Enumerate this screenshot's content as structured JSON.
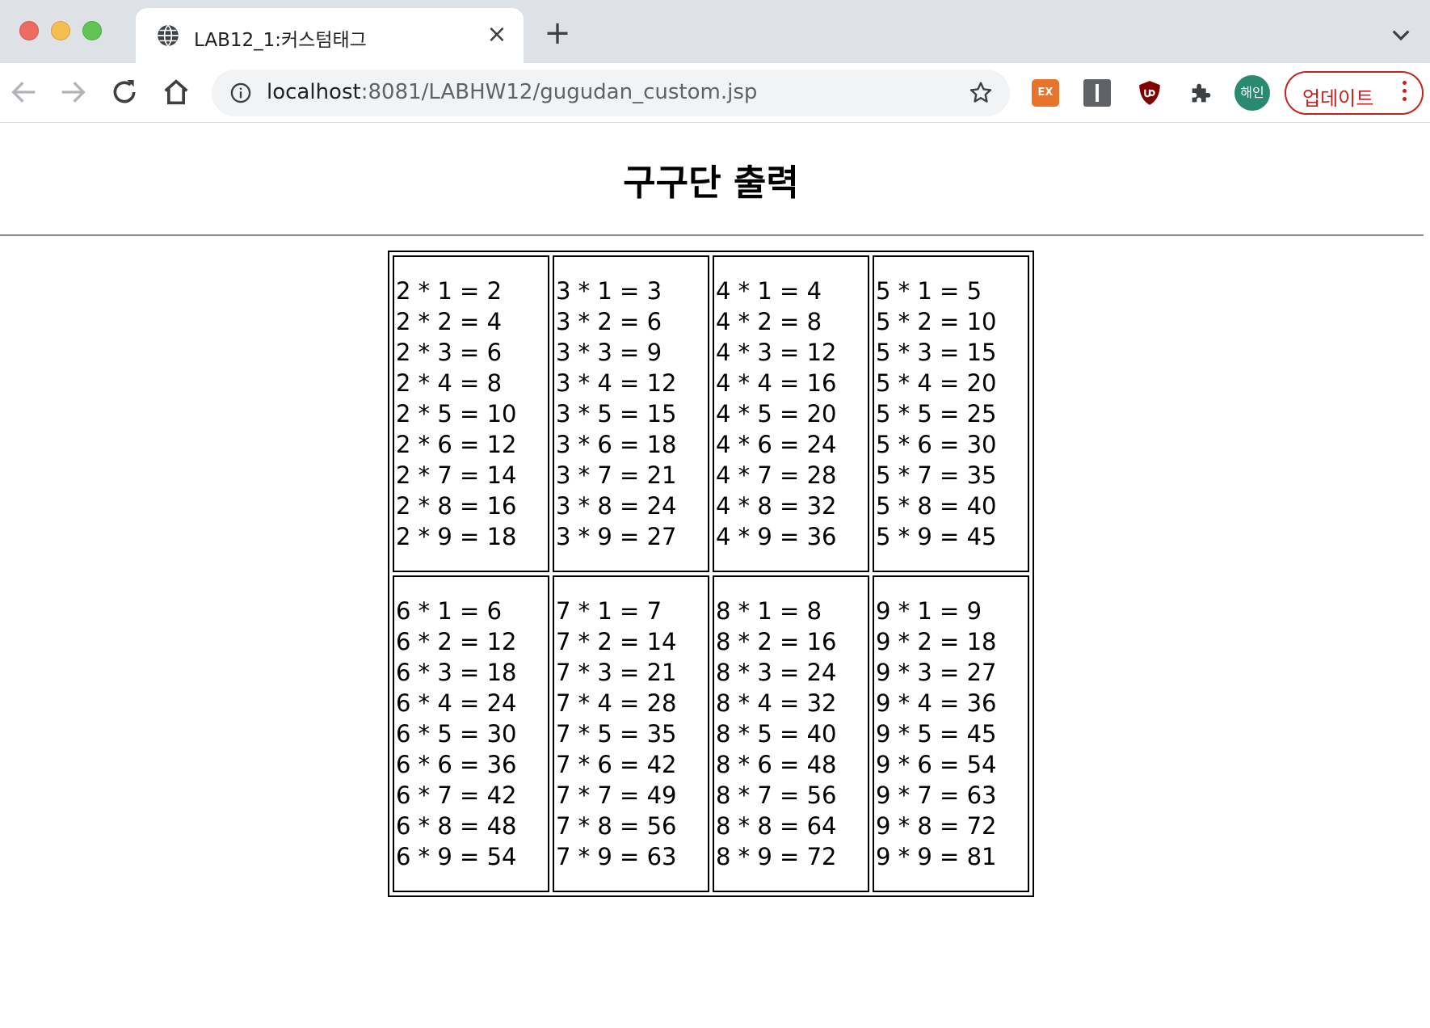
{
  "browser": {
    "tab_title": "LAB12_1:커스텀태그",
    "url_host": "localhost",
    "url_path": ":8081/LABHW12/gugudan_custom.jsp",
    "avatar_label": "해인",
    "update_label": "업데이트",
    "extension_ex_label": "EX"
  },
  "page": {
    "heading": "구구단 출력"
  },
  "table": {
    "rows": [
      {
        "cells": [
          {
            "lines": [
              "2 * 1 = 2",
              "2 * 2 = 4",
              "2 * 3 = 6",
              "2 * 4 = 8",
              "2 * 5 = 10",
              "2 * 6 = 12",
              "2 * 7 = 14",
              "2 * 8 = 16",
              "2 * 9 = 18"
            ]
          },
          {
            "lines": [
              "3 * 1 = 3",
              "3 * 2 = 6",
              "3 * 3 = 9",
              "3 * 4 = 12",
              "3 * 5 = 15",
              "3 * 6 = 18",
              "3 * 7 = 21",
              "3 * 8 = 24",
              "3 * 9 = 27"
            ]
          },
          {
            "lines": [
              "4 * 1 = 4",
              "4 * 2 = 8",
              "4 * 3 = 12",
              "4 * 4 = 16",
              "4 * 5 = 20",
              "4 * 6 = 24",
              "4 * 7 = 28",
              "4 * 8 = 32",
              "4 * 9 = 36"
            ]
          },
          {
            "lines": [
              "5 * 1 = 5",
              "5 * 2 = 10",
              "5 * 3 = 15",
              "5 * 4 = 20",
              "5 * 5 = 25",
              "5 * 6 = 30",
              "5 * 7 = 35",
              "5 * 8 = 40",
              "5 * 9 = 45"
            ]
          }
        ]
      },
      {
        "cells": [
          {
            "lines": [
              "6 * 1 = 6",
              "6 * 2 = 12",
              "6 * 3 = 18",
              "6 * 4 = 24",
              "6 * 5 = 30",
              "6 * 6 = 36",
              "6 * 7 = 42",
              "6 * 8 = 48",
              "6 * 9 = 54"
            ]
          },
          {
            "lines": [
              "7 * 1 = 7",
              "7 * 2 = 14",
              "7 * 3 = 21",
              "7 * 4 = 28",
              "7 * 5 = 35",
              "7 * 6 = 42",
              "7 * 7 = 49",
              "7 * 8 = 56",
              "7 * 9 = 63"
            ]
          },
          {
            "lines": [
              "8 * 1 = 8",
              "8 * 2 = 16",
              "8 * 3 = 24",
              "8 * 4 = 32",
              "8 * 5 = 40",
              "8 * 6 = 48",
              "8 * 7 = 56",
              "8 * 8 = 64",
              "8 * 9 = 72"
            ]
          },
          {
            "lines": [
              "9 * 1 = 9",
              "9 * 2 = 18",
              "9 * 3 = 27",
              "9 * 4 = 36",
              "9 * 5 = 45",
              "9 * 6 = 54",
              "9 * 7 = 63",
              "9 * 8 = 72",
              "9 * 9 = 81"
            ]
          }
        ]
      }
    ]
  }
}
